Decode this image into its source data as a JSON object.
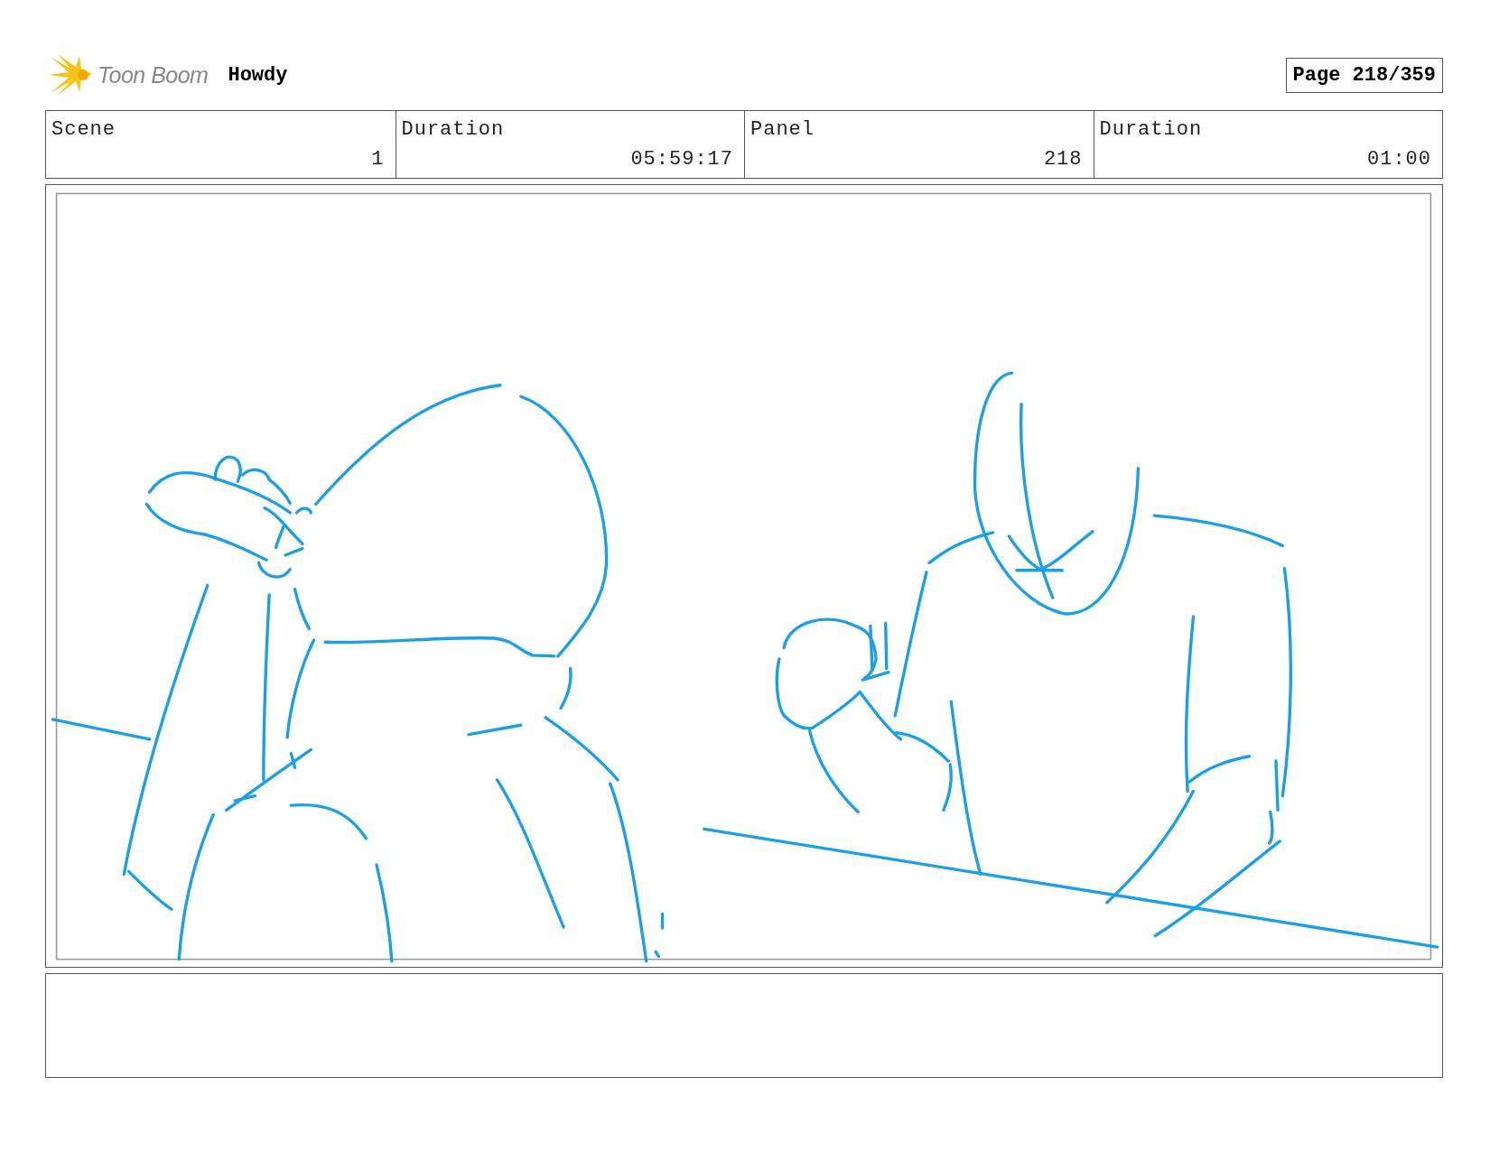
{
  "header": {
    "logo_text": "Toon Boom",
    "project_title": "Howdy",
    "page_label": "Page 218/359"
  },
  "info_fields": [
    {
      "label": "Scene",
      "value": "1"
    },
    {
      "label": "Duration",
      "value": "05:59:17"
    },
    {
      "label": "Panel",
      "value": "218"
    },
    {
      "label": "Duration",
      "value": "01:00"
    }
  ]
}
